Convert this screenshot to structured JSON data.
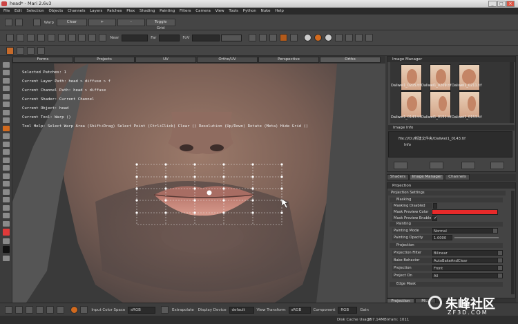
{
  "title": "head* - Mari 2.6v3",
  "menu": [
    "File",
    "Edit",
    "Selection",
    "Objects",
    "Channels",
    "Layers",
    "Patches",
    "Ptex",
    "Shading",
    "Painting",
    "Filters",
    "Camera",
    "View",
    "Tools",
    "Python",
    "Nuke",
    "Help"
  ],
  "toolbar1": {
    "warp_label": "Warp",
    "clear_label": "Clear",
    "plus_label": "+",
    "minus_label": "-",
    "toggle_grid_label": "Toggle Grid"
  },
  "toolbar2": {
    "near_label": "Near",
    "far_label": "Far",
    "fov_label": "FoV"
  },
  "view_tabs": [
    "Forms",
    "Projects",
    "UV",
    "Ortho/UV",
    "Perspective",
    "Ortho"
  ],
  "hud": {
    "selected_patches": "Selected Patches: 1",
    "layer_path": "Current Layer Path: head > diffuse > f",
    "channel_path": "Current Channel Path: head > diffuse",
    "shader": "Current Shader: Current Channel",
    "object": "Current Object: head",
    "tool": "Current Tool: Warp ()",
    "tool_help": "Tool Help: Select Warp Area (Shift+Drag)  Select Point (Ctrl+Click)  Clear ()  Resolution (Up/Down)  Rotate (Meta)  Hide Grid ()"
  },
  "image_manager": {
    "title": "Image Manager",
    "thumbs": [
      "Daliwei1_0205.tif",
      "Daliwei1_0209.tif",
      "Daliwei1_0211.tif",
      "Daliwei1_0143.tif",
      "Daliwei1_0151.tif",
      "Daliwei1_0153.tif"
    ]
  },
  "image_info": {
    "title": "Image Info",
    "file": "file:///D:/新建文件夹/Daliwei1_0143.tif",
    "info": "Info"
  },
  "panel_tabs": [
    "Shaders",
    "Image Manager",
    "Channels"
  ],
  "projection": {
    "title": "Projection",
    "settings": "Projection Settings",
    "masking": "Masking",
    "masking_disabled": "Masking Disabled",
    "mask_preview_color": "Mask Preview Color",
    "mask_preview_color_hex": "#e82a2a",
    "mask_preview_enabled": "Mask Preview Enabled",
    "painting": "Painting",
    "painting_mode_label": "Painting Mode",
    "painting_mode": "Normal",
    "painting_opacity_label": "Painting Opacity",
    "painting_opacity": "1.0000",
    "projection_section": "Projection",
    "projection_filter_label": "Projection Filter",
    "projection_filter": "Bilinear",
    "bake_behavior_label": "Bake Behavior",
    "bake_behavior": "AutoBakeAndClear",
    "projection_label": "Projection",
    "projection_value": "Front",
    "project_on_label": "Project On",
    "project_on": "All",
    "edge_mask": "Edge Mask"
  },
  "bottom_tabs": [
    "Projection",
    "Mi..."
  ],
  "statusbar": {
    "input_color_space": "Input Color Space",
    "input_cs_value": "sRGB",
    "extrapolate": "Extrapolate",
    "display_device": "Display Device",
    "display_device_value": "default",
    "view_transform": "View Transform",
    "view_transform_value": "sRGB",
    "component": "Component",
    "component_value": "RGB",
    "gain": "Gain"
  },
  "bottombar": {
    "cache": "Disk Cache Usage",
    "cache_value": "357.14MB",
    "vram": "Vram: 1011"
  },
  "watermark": {
    "brand": "朱峰社区",
    "url": "ZF3D.COM"
  }
}
